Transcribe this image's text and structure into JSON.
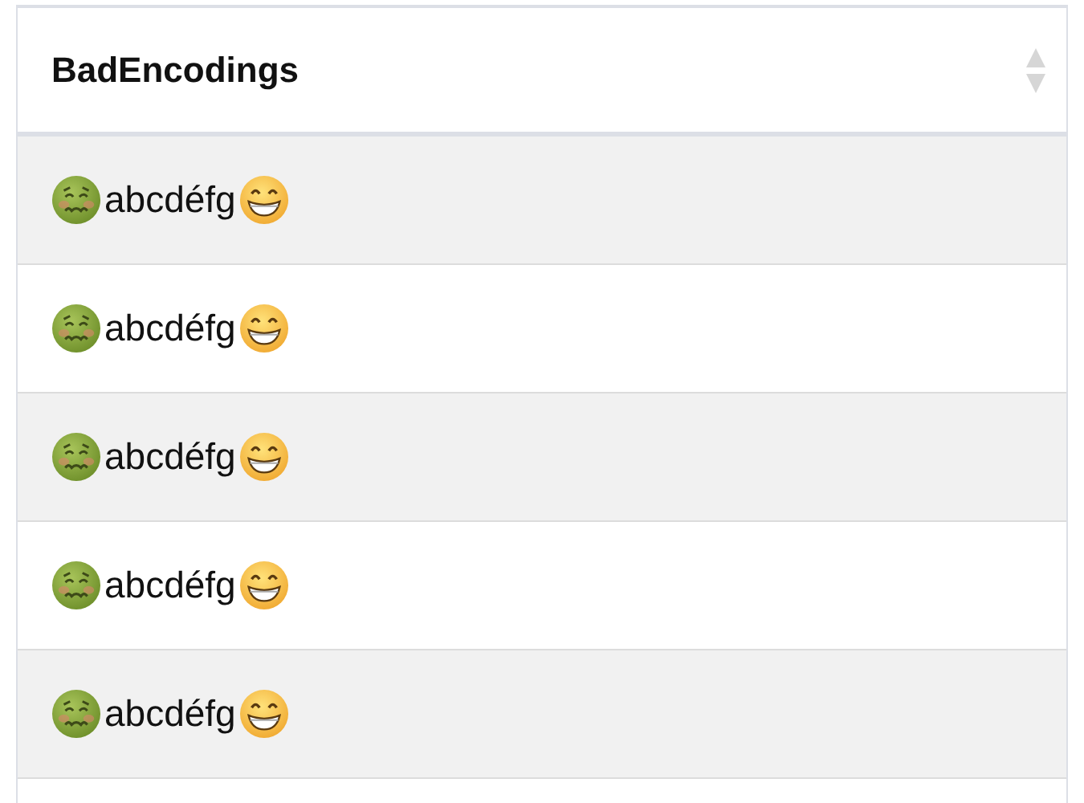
{
  "table": {
    "columns": [
      {
        "label": "BadEncodings"
      }
    ],
    "rows": [
      {
        "text": "abcdéfg"
      },
      {
        "text": "abcdéfg"
      },
      {
        "text": "abcdéfg"
      },
      {
        "text": "abcdéfg"
      },
      {
        "text": "abcdéfg"
      }
    ]
  }
}
